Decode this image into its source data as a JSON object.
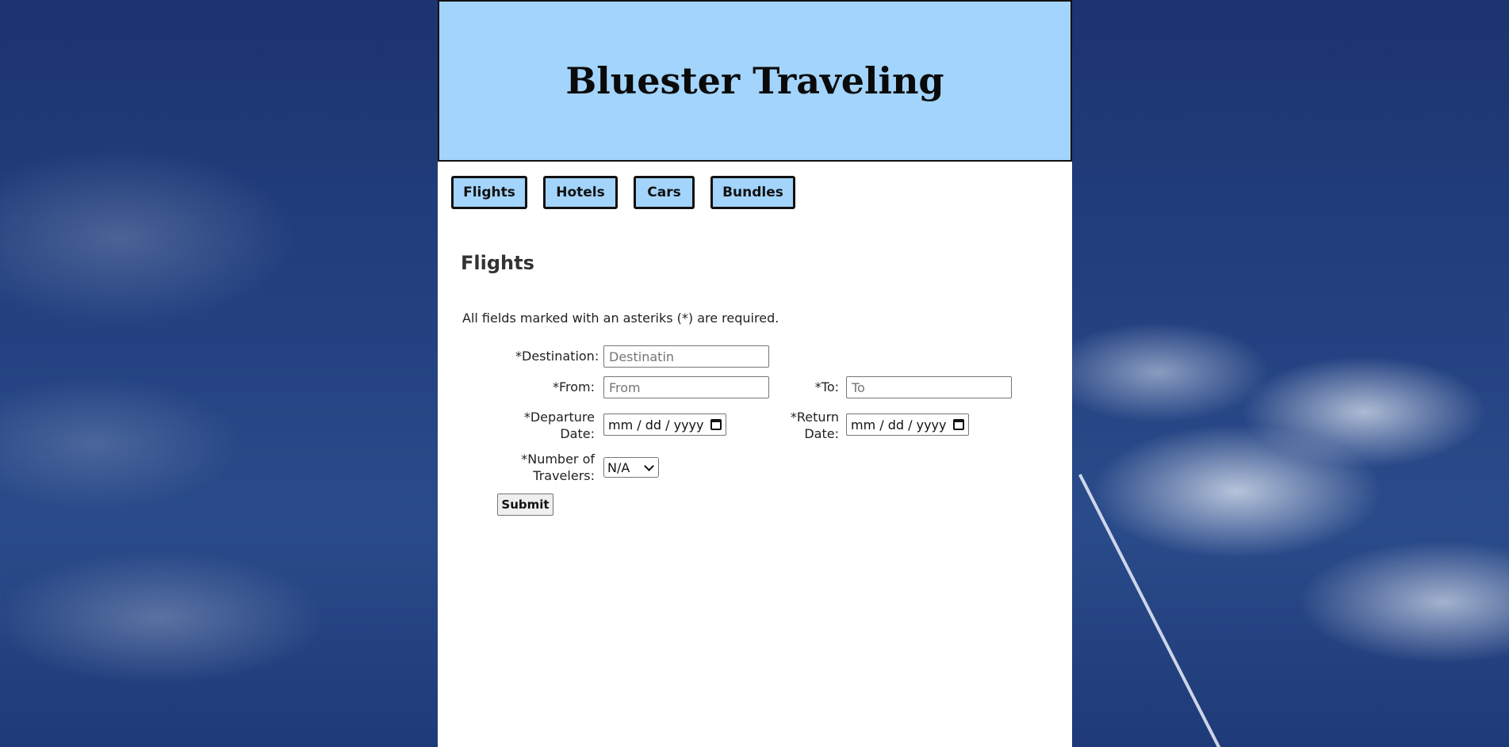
{
  "site": {
    "title": "Bluester Traveling"
  },
  "nav": {
    "items": [
      {
        "label": "Flights"
      },
      {
        "label": "Hotels"
      },
      {
        "label": "Cars"
      },
      {
        "label": "Bundles"
      }
    ]
  },
  "main": {
    "section_title": "Flights",
    "required_note": "All fields marked with an asteriks (*) are required."
  },
  "form": {
    "destination": {
      "label": "*Destination:",
      "placeholder": "Destinatin",
      "value": ""
    },
    "from": {
      "label": "*From:",
      "placeholder": "From",
      "value": ""
    },
    "to": {
      "label": "*To:",
      "placeholder": "To",
      "value": ""
    },
    "departure_date": {
      "label_line1": "*Departure",
      "label_line2": "Date:",
      "value": "mm / dd / yyyy"
    },
    "return_date": {
      "label_line1": "*Return",
      "label_line2": "Date:",
      "value": "mm / dd / yyyy"
    },
    "travelers": {
      "label_line1": "*Number of",
      "label_line2": "Travelers:",
      "selected": "N/A"
    },
    "submit_label": "Submit"
  },
  "colors": {
    "header_bg": "#a3d4fb",
    "nav_button_bg": "#a3d4fb",
    "page_bg": "#ffffff",
    "sky": "#23407f"
  },
  "icons": {
    "date_picker": "calendar-icon",
    "select": "chevron-down-icon"
  }
}
